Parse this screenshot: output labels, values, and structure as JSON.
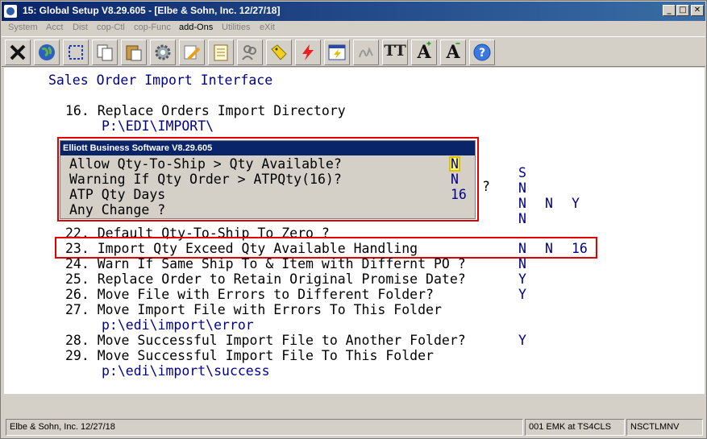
{
  "window": {
    "title": "15: Global Setup V8.29.605 - [Elbe & Sohn, Inc. 12/27/18]",
    "minimize": "_",
    "maximize": "□",
    "close": "✕"
  },
  "menu": [
    "System",
    "Acct",
    "Dist",
    "cop-Ctl",
    "cop-Func",
    "add-Ons",
    "Utilities",
    "eXit"
  ],
  "toolbar": {
    "icons": [
      "close-x-icon",
      "globe-icon",
      "select-icon",
      "copy-icon",
      "paste-icon",
      "settings-gear-icon",
      "edit-pencil-icon",
      "notepad-icon",
      "users-icon",
      "tag-icon",
      "lightning-icon",
      "window-lightning-icon",
      "signature-icon",
      "font-tt-icon",
      "font-grow-icon",
      "font-shrink-icon",
      "help-icon"
    ],
    "font_tt": "TT",
    "font_grow": "A",
    "font_shrink": "A"
  },
  "screen": {
    "heading": "Sales Order Import Interface",
    "line16": "16. Replace Orders Import Directory",
    "line16_path": "P:\\EDI\\IMPORT\\",
    "line17_fragment": "                    ",
    "line17_q": "?",
    "col_s": "S",
    "line_r_n1": "N",
    "line_r_n2": "N",
    "row21": {
      "c1": "N",
      "c2": "N",
      "c3": "Y"
    },
    "line21_n": "N",
    "line22": "22. Default Qty-To-Ship To Zero ?",
    "line23": "23. Import Qty Exceed Qty Available Handling",
    "line23_vals": {
      "c1": "N",
      "c2": "N",
      "c3": "16"
    },
    "line24": "24. Warn If Same Ship To & Item with Differnt PO ?",
    "line24_val": "N",
    "line25": "25. Replace Order to Retain Original Promise Date?",
    "line25_val": "Y",
    "line26": "26. Move File with Errors to Different Folder?",
    "line26_val": "Y",
    "line27": "27. Move Import File with Errors To This Folder",
    "line27_path": "p:\\edi\\import\\error",
    "line28": "28. Move Successful Import File to Another Folder?",
    "line28_val": "Y",
    "line29": "29. Move Successful Import File To This Folder",
    "line29_path": "p:\\edi\\import\\success"
  },
  "popup": {
    "title": "Elliott Business Software V8.29.605",
    "q1": "Allow Qty-To-Ship > Qty Available?",
    "q1_val": "N",
    "q2": "Warning If Qty Order > ATPQty(16)?",
    "q2_val": "N",
    "q3": "ATP Qty Days",
    "q3_val": "16",
    "q4": "Any Change ?"
  },
  "status": {
    "company": "Elbe & Sohn, Inc. 12/27/18",
    "user": "001 EMK at TS4CLS",
    "program": "NSCTLMNV"
  },
  "colors": {
    "title_blue": "#0a246a",
    "path_blue": "#00008b",
    "highlight_red": "#e00000",
    "cursor_yellow": "#ffff66"
  }
}
